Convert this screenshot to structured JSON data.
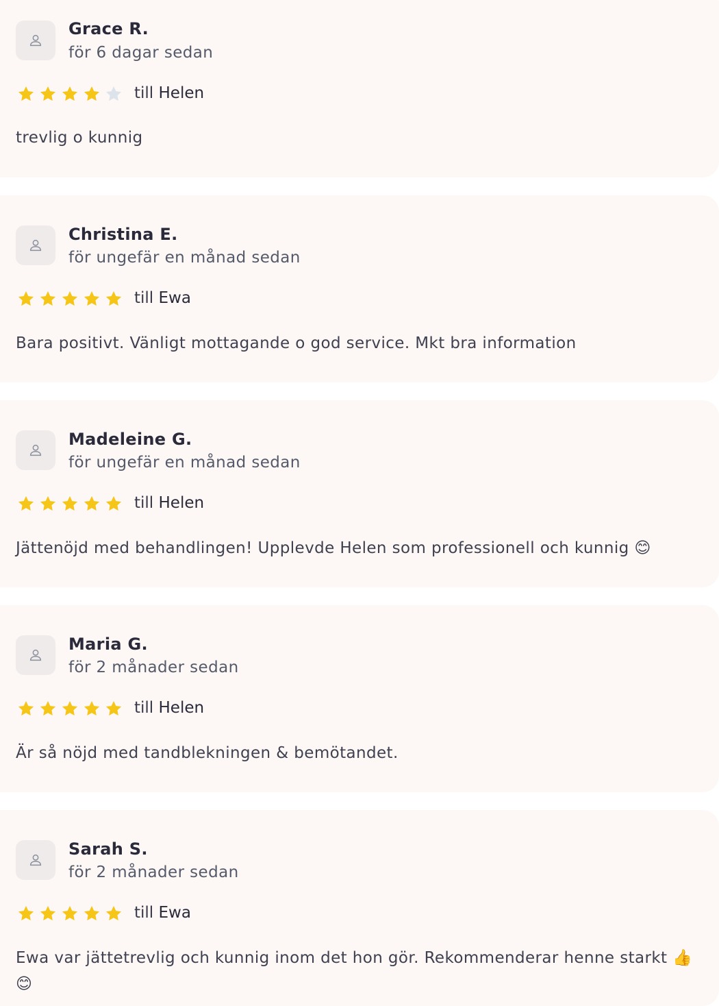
{
  "colors": {
    "card_bg": "#fdf8f5",
    "star_filled": "#f5c518",
    "star_empty": "#dde3ea"
  },
  "reviews": [
    {
      "name": "Grace R.",
      "date": "för 6 dagar sedan",
      "rating": 4,
      "to_prefix": "till",
      "staff": "Helen",
      "text": "trevlig o kunnig"
    },
    {
      "name": "Christina E.",
      "date": "för ungefär en månad sedan",
      "rating": 5,
      "to_prefix": "till",
      "staff": "Ewa",
      "text": "Bara positivt. Vänligt mottagande o god service. Mkt bra information"
    },
    {
      "name": "Madeleine G.",
      "date": "för ungefär en månad sedan",
      "rating": 5,
      "to_prefix": "till",
      "staff": "Helen",
      "text": "Jättenöjd med behandlingen! Upplevde Helen som professionell och kunnig 😊"
    },
    {
      "name": "Maria G.",
      "date": "för 2 månader sedan",
      "rating": 5,
      "to_prefix": "till",
      "staff": "Helen",
      "text": "Är så nöjd med tandblekningen & bemötandet."
    },
    {
      "name": "Sarah S.",
      "date": "för 2 månader sedan",
      "rating": 5,
      "to_prefix": "till",
      "staff": "Ewa",
      "text": "Ewa var jättetrevlig och kunnig inom det hon gör. Rekommenderar henne starkt 👍😊"
    }
  ]
}
